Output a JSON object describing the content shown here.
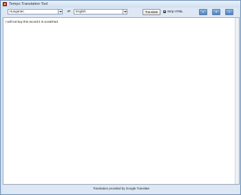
{
  "window": {
    "title": "Tempo Translation Tool"
  },
  "toolbar": {
    "source_language": "Hungarian",
    "swap_icon": "swap-arrows-icon",
    "swap_glyph": "⇄",
    "target_language": "English",
    "translate_label": "Translate",
    "strip_html_label": "Strip HTML",
    "strip_html_checked": true,
    "icon_buttons": [
      {
        "name": "settings-icon",
        "glyph": "≡"
      },
      {
        "name": "help-icon",
        "glyph": "?"
      },
      {
        "name": "info-icon",
        "glyph": "i"
      }
    ]
  },
  "main": {
    "text": "I will not buy this record it is scratched."
  },
  "footer": {
    "credit": "Translation provided by Google Translate"
  }
}
